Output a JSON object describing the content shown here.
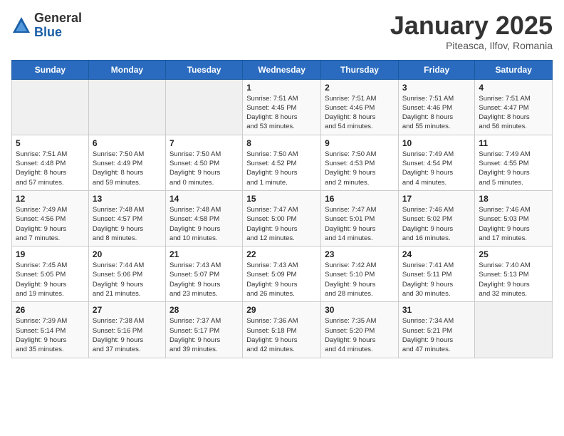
{
  "header": {
    "logo_general": "General",
    "logo_blue": "Blue",
    "month_title": "January 2025",
    "subtitle": "Piteasca, Ilfov, Romania"
  },
  "weekdays": [
    "Sunday",
    "Monday",
    "Tuesday",
    "Wednesday",
    "Thursday",
    "Friday",
    "Saturday"
  ],
  "weeks": [
    [
      {
        "day": "",
        "info": ""
      },
      {
        "day": "",
        "info": ""
      },
      {
        "day": "",
        "info": ""
      },
      {
        "day": "1",
        "info": "Sunrise: 7:51 AM\nSunset: 4:45 PM\nDaylight: 8 hours\nand 53 minutes."
      },
      {
        "day": "2",
        "info": "Sunrise: 7:51 AM\nSunset: 4:46 PM\nDaylight: 8 hours\nand 54 minutes."
      },
      {
        "day": "3",
        "info": "Sunrise: 7:51 AM\nSunset: 4:46 PM\nDaylight: 8 hours\nand 55 minutes."
      },
      {
        "day": "4",
        "info": "Sunrise: 7:51 AM\nSunset: 4:47 PM\nDaylight: 8 hours\nand 56 minutes."
      }
    ],
    [
      {
        "day": "5",
        "info": "Sunrise: 7:51 AM\nSunset: 4:48 PM\nDaylight: 8 hours\nand 57 minutes."
      },
      {
        "day": "6",
        "info": "Sunrise: 7:50 AM\nSunset: 4:49 PM\nDaylight: 8 hours\nand 59 minutes."
      },
      {
        "day": "7",
        "info": "Sunrise: 7:50 AM\nSunset: 4:50 PM\nDaylight: 9 hours\nand 0 minutes."
      },
      {
        "day": "8",
        "info": "Sunrise: 7:50 AM\nSunset: 4:52 PM\nDaylight: 9 hours\nand 1 minute."
      },
      {
        "day": "9",
        "info": "Sunrise: 7:50 AM\nSunset: 4:53 PM\nDaylight: 9 hours\nand 2 minutes."
      },
      {
        "day": "10",
        "info": "Sunrise: 7:49 AM\nSunset: 4:54 PM\nDaylight: 9 hours\nand 4 minutes."
      },
      {
        "day": "11",
        "info": "Sunrise: 7:49 AM\nSunset: 4:55 PM\nDaylight: 9 hours\nand 5 minutes."
      }
    ],
    [
      {
        "day": "12",
        "info": "Sunrise: 7:49 AM\nSunset: 4:56 PM\nDaylight: 9 hours\nand 7 minutes."
      },
      {
        "day": "13",
        "info": "Sunrise: 7:48 AM\nSunset: 4:57 PM\nDaylight: 9 hours\nand 8 minutes."
      },
      {
        "day": "14",
        "info": "Sunrise: 7:48 AM\nSunset: 4:58 PM\nDaylight: 9 hours\nand 10 minutes."
      },
      {
        "day": "15",
        "info": "Sunrise: 7:47 AM\nSunset: 5:00 PM\nDaylight: 9 hours\nand 12 minutes."
      },
      {
        "day": "16",
        "info": "Sunrise: 7:47 AM\nSunset: 5:01 PM\nDaylight: 9 hours\nand 14 minutes."
      },
      {
        "day": "17",
        "info": "Sunrise: 7:46 AM\nSunset: 5:02 PM\nDaylight: 9 hours\nand 16 minutes."
      },
      {
        "day": "18",
        "info": "Sunrise: 7:46 AM\nSunset: 5:03 PM\nDaylight: 9 hours\nand 17 minutes."
      }
    ],
    [
      {
        "day": "19",
        "info": "Sunrise: 7:45 AM\nSunset: 5:05 PM\nDaylight: 9 hours\nand 19 minutes."
      },
      {
        "day": "20",
        "info": "Sunrise: 7:44 AM\nSunset: 5:06 PM\nDaylight: 9 hours\nand 21 minutes."
      },
      {
        "day": "21",
        "info": "Sunrise: 7:43 AM\nSunset: 5:07 PM\nDaylight: 9 hours\nand 23 minutes."
      },
      {
        "day": "22",
        "info": "Sunrise: 7:43 AM\nSunset: 5:09 PM\nDaylight: 9 hours\nand 26 minutes."
      },
      {
        "day": "23",
        "info": "Sunrise: 7:42 AM\nSunset: 5:10 PM\nDaylight: 9 hours\nand 28 minutes."
      },
      {
        "day": "24",
        "info": "Sunrise: 7:41 AM\nSunset: 5:11 PM\nDaylight: 9 hours\nand 30 minutes."
      },
      {
        "day": "25",
        "info": "Sunrise: 7:40 AM\nSunset: 5:13 PM\nDaylight: 9 hours\nand 32 minutes."
      }
    ],
    [
      {
        "day": "26",
        "info": "Sunrise: 7:39 AM\nSunset: 5:14 PM\nDaylight: 9 hours\nand 35 minutes."
      },
      {
        "day": "27",
        "info": "Sunrise: 7:38 AM\nSunset: 5:16 PM\nDaylight: 9 hours\nand 37 minutes."
      },
      {
        "day": "28",
        "info": "Sunrise: 7:37 AM\nSunset: 5:17 PM\nDaylight: 9 hours\nand 39 minutes."
      },
      {
        "day": "29",
        "info": "Sunrise: 7:36 AM\nSunset: 5:18 PM\nDaylight: 9 hours\nand 42 minutes."
      },
      {
        "day": "30",
        "info": "Sunrise: 7:35 AM\nSunset: 5:20 PM\nDaylight: 9 hours\nand 44 minutes."
      },
      {
        "day": "31",
        "info": "Sunrise: 7:34 AM\nSunset: 5:21 PM\nDaylight: 9 hours\nand 47 minutes."
      },
      {
        "day": "",
        "info": ""
      }
    ]
  ]
}
